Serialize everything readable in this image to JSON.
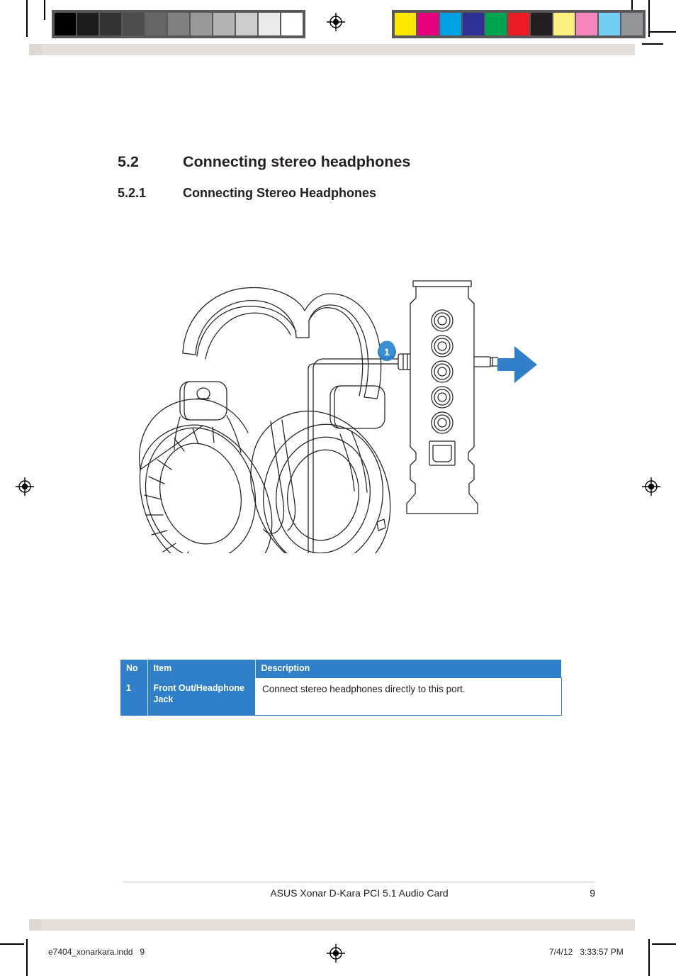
{
  "document": {
    "headings": [
      {
        "number": "5.2",
        "title": "Connecting stereo headphones"
      },
      {
        "number": "5.2.1",
        "title": "Connecting Stereo Headphones"
      }
    ],
    "footer": {
      "title": "ASUS Xonar D-Kara PCI 5.1 Audio Card",
      "page_number": "9"
    },
    "print_info": {
      "file": "e7404_xonarkara.indd   9",
      "timestamp": "7/4/12   3:33:57 PM"
    }
  },
  "figure": {
    "callout_label": "1",
    "callout_color": "#2f80c8",
    "arrow_color": "#2f80c8",
    "line_color": "#231f20",
    "parts": {
      "headphones": "stereo-headphones-illustration",
      "cable": "headphone-cable",
      "plug": "3.5mm-stereo-plug",
      "bracket": "audio-card-rear-bracket",
      "jacks": 5,
      "spdif_port": 1
    }
  },
  "table": {
    "headers": [
      "No",
      "Item",
      "Description"
    ],
    "rows": [
      {
        "no": "1",
        "item": "Front Out/Headphone Jack",
        "description": "Connect stereo headphones directly to this port."
      }
    ],
    "header_bg": "#2f80c8"
  },
  "calibration": {
    "grayscale": [
      "#000000",
      "#1c1c1c",
      "#333333",
      "#4d4d4d",
      "#666666",
      "#808080",
      "#999999",
      "#b3b3b3",
      "#cccccc",
      "#ebebeb",
      "#ffffff"
    ],
    "colors": [
      "#ffe800",
      "#e6007e",
      "#00a0e3",
      "#2e3192",
      "#00a551",
      "#ed1c24",
      "#231f20",
      "#fdf07f",
      "#f585bd",
      "#74cef2",
      "#939598"
    ]
  }
}
